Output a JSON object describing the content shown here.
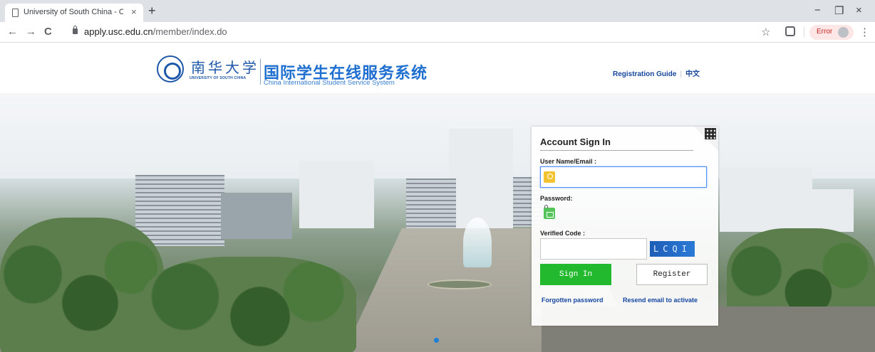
{
  "browser": {
    "tab_title": "University of South China - Onl",
    "tab_close": "×",
    "new_tab": "+",
    "url_host": "apply.usc.edu.cn",
    "url_path": "/member/index.do",
    "back": "←",
    "forward": "→",
    "reload": "C",
    "star": "☆",
    "error_label": "Error",
    "menu": "⋮",
    "minimize": "−",
    "maximize": "❐",
    "close": "×"
  },
  "header": {
    "university_calligraphy": "南华大学",
    "university_en": "UNIVERSITY OF SOUTH CHINA",
    "system_title_cn": "国际学生在线服务系统",
    "system_title_en": "China International Student Service System",
    "links": {
      "guide": "Registration Guide",
      "separator": "|",
      "language": "中文"
    }
  },
  "login": {
    "title": "Account Sign In",
    "username_label": "User Name/Email :",
    "username_value": "",
    "password_label": "Password:",
    "password_value": "",
    "code_label": "Verified Code :",
    "code_value": "",
    "captcha_text": "LCQI",
    "signin_label": "Sign In",
    "register_label": "Register",
    "forgot_link": "Forgotten password",
    "resend_link": "Resend email to activate"
  },
  "colors": {
    "brand_blue": "#1f6fd0",
    "signin_green": "#22b92f",
    "link_blue": "#1646a0"
  }
}
